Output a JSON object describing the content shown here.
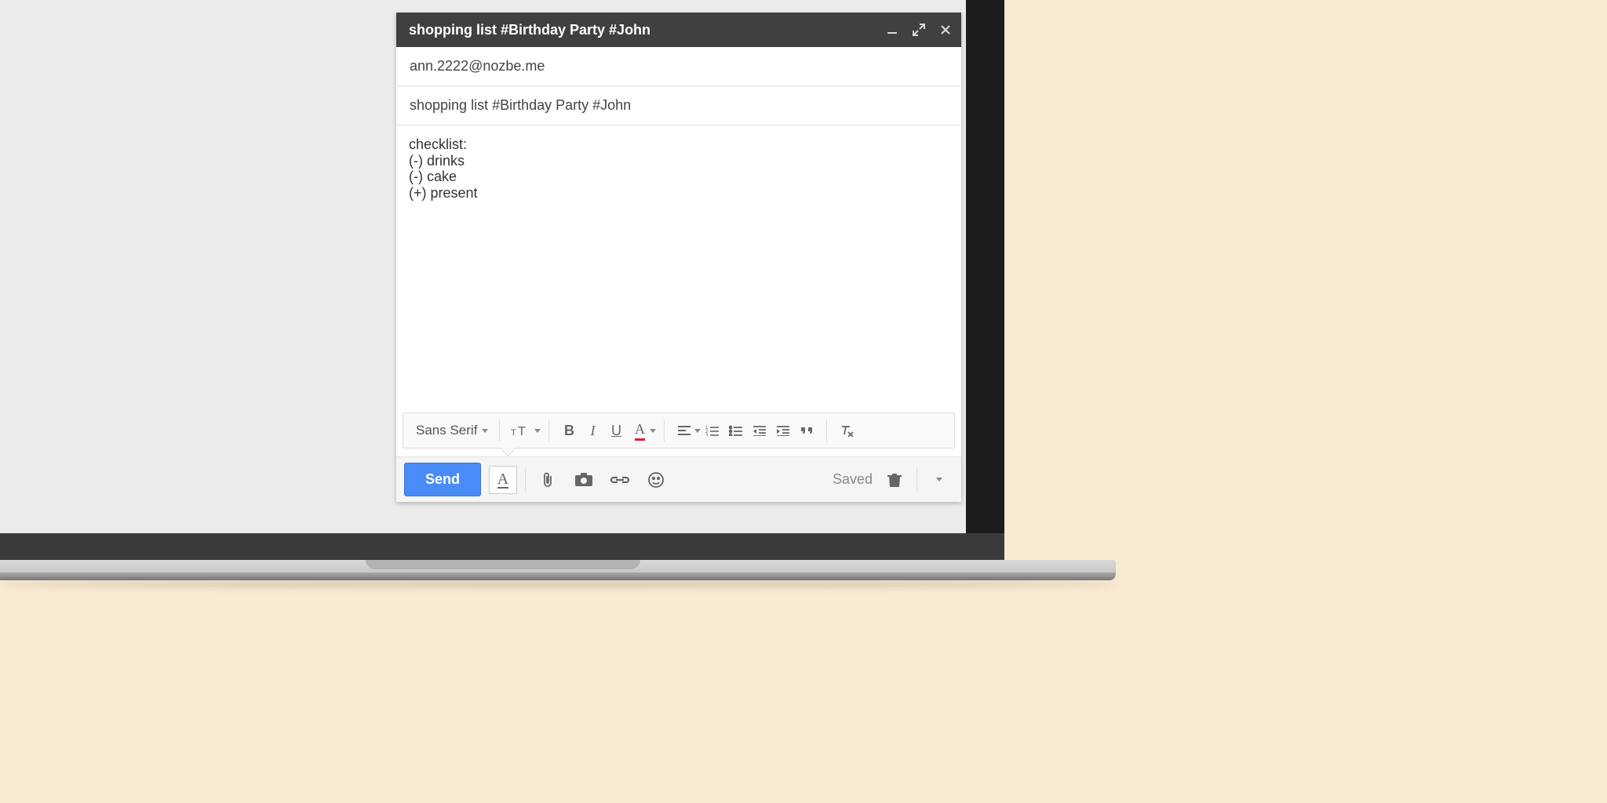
{
  "compose": {
    "title": "shopping list #Birthday Party #John",
    "to": "ann.2222@nozbe.me",
    "subject": "shopping list #Birthday Party #John",
    "body_lines": [
      "checklist:",
      "(-) drinks",
      "(-) cake",
      "(+) present"
    ]
  },
  "format_toolbar": {
    "font_label": "Sans Serif"
  },
  "bottom_toolbar": {
    "send_label": "Send",
    "saved_label": "Saved"
  },
  "colors": {
    "send_button": "#4a8cf7",
    "header_bg": "#404040",
    "status_dot": "#2ebd63"
  }
}
